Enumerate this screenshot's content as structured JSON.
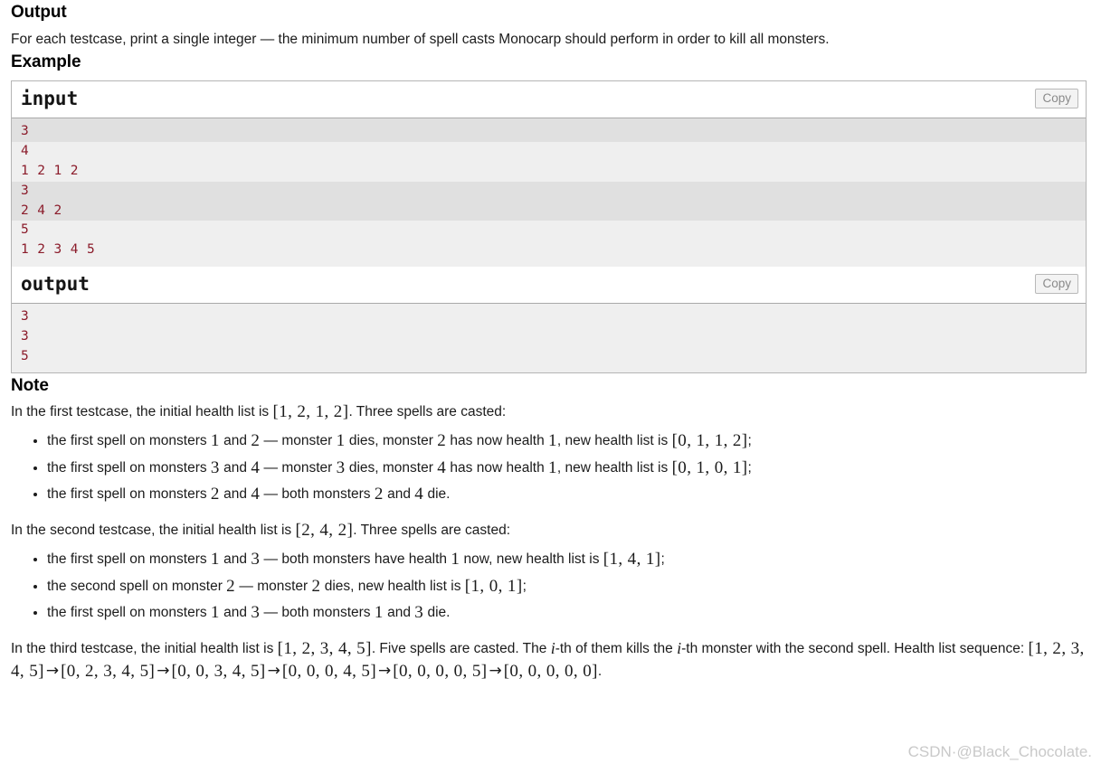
{
  "output_section": {
    "heading": "Output",
    "description": "For each testcase, print a single integer — the minimum number of spell casts Monocarp should perform in order to kill all monsters."
  },
  "example_section": {
    "heading": "Example",
    "input_block": {
      "title": "input",
      "copy_label": "Copy",
      "lines": [
        {
          "text": "3",
          "group": "even"
        },
        {
          "text": "4",
          "group": "odd"
        },
        {
          "text": "1 2 1 2",
          "group": "odd"
        },
        {
          "text": "3",
          "group": "even"
        },
        {
          "text": "2 4 2",
          "group": "even"
        },
        {
          "text": "5",
          "group": "odd"
        },
        {
          "text": "1 2 3 4 5",
          "group": "odd"
        }
      ]
    },
    "output_block": {
      "title": "output",
      "copy_label": "Copy",
      "lines": [
        {
          "text": "3",
          "group": "odd"
        },
        {
          "text": "3",
          "group": "odd"
        },
        {
          "text": "5",
          "group": "odd"
        }
      ]
    }
  },
  "note_section": {
    "heading": "Note",
    "testcase1": {
      "intro_pre": "In the first testcase, the initial health list is ",
      "intro_math": "[1, 2, 1, 2]",
      "intro_post": ". Three spells are casted:",
      "bullets": [
        {
          "t1": "the first spell on monsters ",
          "m1": "1",
          "t2": " and ",
          "m2": "2",
          "t3": " — monster ",
          "m3": "1",
          "t4": " dies, monster ",
          "m4": "2",
          "t5": " has now health ",
          "m5": "1",
          "t6": ", new health list is ",
          "m6": "[0, 1, 1, 2]",
          "t7": ";"
        },
        {
          "t1": "the first spell on monsters ",
          "m1": "3",
          "t2": " and ",
          "m2": "4",
          "t3": " — monster ",
          "m3": "3",
          "t4": " dies, monster ",
          "m4": "4",
          "t5": " has now health ",
          "m5": "1",
          "t6": ", new health list is ",
          "m6": "[0, 1, 0, 1]",
          "t7": ";"
        },
        {
          "t1": "the first spell on monsters ",
          "m1": "2",
          "t2": " and ",
          "m2": "4",
          "t3": " — both monsters ",
          "m3": "2",
          "t4": " and ",
          "m4": "4",
          "t5": " die.",
          "m5": "",
          "t6": "",
          "m6": "",
          "t7": ""
        }
      ]
    },
    "testcase2": {
      "intro_pre": "In the second testcase, the initial health list is ",
      "intro_math": "[2, 4, 2]",
      "intro_post": ". Three spells are casted:",
      "bullets": [
        {
          "t1": "the first spell on monsters ",
          "m1": "1",
          "t2": " and ",
          "m2": "3",
          "t3": " — both monsters have health ",
          "m3": "1",
          "t4": " now, new health list is ",
          "m4": "[1, 4, 1]",
          "t5": ";"
        },
        {
          "t1": "the second spell on monster ",
          "m1": "2",
          "t2": " — monster ",
          "m2": "2",
          "t3": " dies, new health list is ",
          "m3": "[1, 0, 1]",
          "t4": ";",
          "m4": "",
          "t5": ""
        },
        {
          "t1": "the first spell on monsters ",
          "m1": "1",
          "t2": " and ",
          "m2": "3",
          "t3": " — both monsters ",
          "m3": "1",
          "t4": " and ",
          "m4": "3",
          "t5": " die."
        }
      ]
    },
    "testcase3": {
      "p_a": "In the third testcase, the initial health list is ",
      "p_a_math": "[1, 2, 3, 4, 5]",
      "p_b": ". Five spells are casted. The ",
      "p_b_it": "i",
      "p_c": "-th of them kills the ",
      "p_c_it": "i",
      "p_d": "-th monster with the second spell. Health list sequence: ",
      "seq": [
        "[1, 2, 3, 4, 5]",
        "[0, 2, 3, 4, 5]",
        "[0, 0, 3, 4, 5]",
        "[0, 0, 0, 4, 5]",
        "[0, 0, 0, 0, 5]",
        "[0, 0, 0, 0, 0]"
      ],
      "seq_arrow": "→",
      "p_end": "."
    }
  },
  "watermark": {
    "text": "CSDN·@Black_Chocolate."
  },
  "colors": {
    "sample_text": "#8b1c2b",
    "stripe_dark": "#e0e0e0",
    "stripe_light": "#efefef",
    "border": "#b5b5b5"
  }
}
